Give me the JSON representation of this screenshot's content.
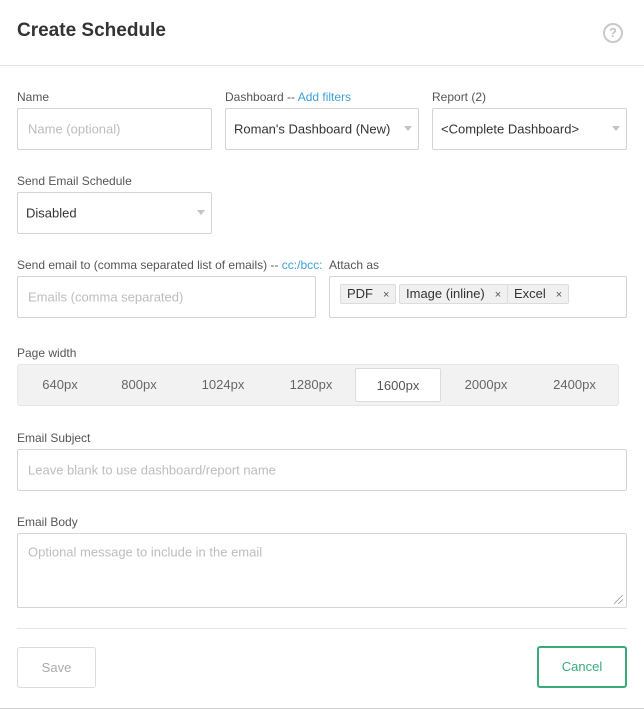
{
  "header": {
    "title": "Create Schedule",
    "help_glyph": "?"
  },
  "name": {
    "label": "Name",
    "placeholder": "Name (optional)"
  },
  "dashboard": {
    "label": "Dashboard --",
    "link": "Add filters",
    "value": "Roman's Dashboard (New)"
  },
  "report": {
    "label": "Report (2)",
    "value": "<Complete Dashboard>"
  },
  "email_schedule": {
    "label": "Send Email Schedule",
    "value": "Disabled"
  },
  "send_to": {
    "label": "Send email to (comma separated list of emails) --",
    "link": "cc:/bcc:",
    "placeholder": "Emails (comma separated)"
  },
  "attach": {
    "label": "Attach as",
    "tags": [
      "PDF",
      "Image (inline)",
      "Excel"
    ],
    "remove_glyph": "×"
  },
  "page_width": {
    "label": "Page width",
    "options": [
      "640px",
      "800px",
      "1024px",
      "1280px",
      "1600px",
      "2000px",
      "2400px"
    ],
    "selected": "1600px"
  },
  "subject": {
    "label": "Email Subject",
    "placeholder": "Leave blank to use dashboard/report name"
  },
  "body": {
    "label": "Email Body",
    "placeholder": "Optional message to include in the email"
  },
  "actions": {
    "save": "Save",
    "cancel": "Cancel"
  },
  "colors": {
    "link": "#3ea1d6",
    "cancel_accent": "#3aaa78"
  }
}
